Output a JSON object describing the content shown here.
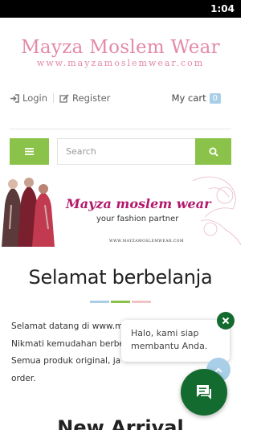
{
  "status_bar": {
    "time": "1:04"
  },
  "logo": {
    "title": "Mayza Moslem Wear",
    "url": "www.mayzamoslemwear.com"
  },
  "account": {
    "login": "Login",
    "register": "Register"
  },
  "cart": {
    "label": "My cart",
    "count": "0"
  },
  "search": {
    "placeholder": "Search"
  },
  "banner": {
    "title": "Mayza moslem wear",
    "subtitle": "your fashion partner",
    "url": "WWW.MAYZAMOSLEMWEAR.COM"
  },
  "welcome": {
    "title": "Selamat berbelanja",
    "lines": [
      "Selamat datang di www.m",
      "Nikmati kemudahan berbe",
      "Semua produk original, ja",
      "order."
    ]
  },
  "new_arrival": {
    "title": "New Arrival"
  },
  "chat": {
    "message": "Halo, kami siap membantu Anda."
  },
  "colors": {
    "green": "#8bc34a",
    "brand_pink": "#e38aa8",
    "whatsapp_green": "#146b2f",
    "light_blue": "#a9cfe8"
  },
  "icons": [
    "sign-in-icon",
    "edit-icon",
    "menu-icon",
    "search-icon",
    "close-icon",
    "arrow-up-icon",
    "chat-icon"
  ]
}
